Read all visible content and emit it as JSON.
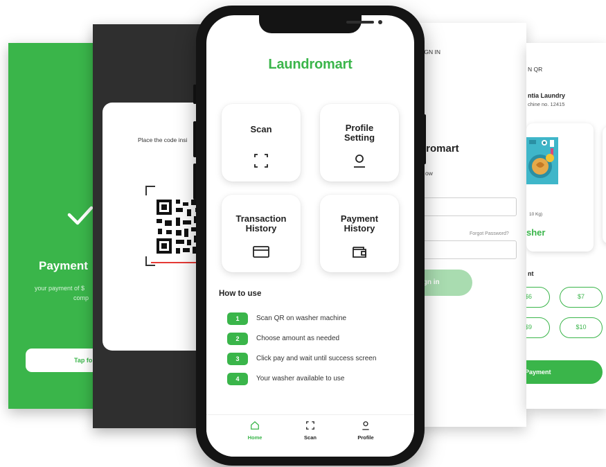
{
  "brand": {
    "name": "Laundromart",
    "color": "#3ab54a"
  },
  "success_screen": {
    "title": "Payment",
    "message_line1": "your payment of $",
    "message_line2": "comp",
    "button": "Tap for"
  },
  "scan_screen": {
    "hint": "Place the code insi"
  },
  "signin_screen": {
    "top_label": "IGN IN",
    "brand_partial": "dromart",
    "subtitle": "ow",
    "forgot": "Forgot Password?",
    "button": "ign in"
  },
  "pay_screen": {
    "top_label": "N QR",
    "store": "ntia Laundry",
    "machine": "chine no. 12415",
    "capacity": "10 Kg)",
    "type": "sher",
    "amount_label": "nt",
    "amounts": [
      "$6",
      "$7",
      "$9",
      "$10"
    ],
    "button": "Payment"
  },
  "home": {
    "title": "Laundromart",
    "tiles": [
      {
        "label": "Scan",
        "icon": "scan-icon"
      },
      {
        "label": "Profile Setting",
        "icon": "profile-icon"
      },
      {
        "label": "Transaction History",
        "icon": "card-icon"
      },
      {
        "label": "Payment History",
        "icon": "wallet-icon"
      }
    ],
    "how_to_title": "How to use",
    "steps": [
      {
        "num": "1",
        "text": "Scan QR on washer machine"
      },
      {
        "num": "2",
        "text": "Choose amount as needed"
      },
      {
        "num": "3",
        "text": "Click pay and wait until success screen"
      },
      {
        "num": "4",
        "text": "Your washer available to use"
      }
    ],
    "tabs": [
      {
        "label": "Home",
        "icon": "home-icon",
        "active": true
      },
      {
        "label": "Scan",
        "icon": "scan-icon",
        "active": false
      },
      {
        "label": "Profile",
        "icon": "profile-icon",
        "active": false
      }
    ]
  }
}
